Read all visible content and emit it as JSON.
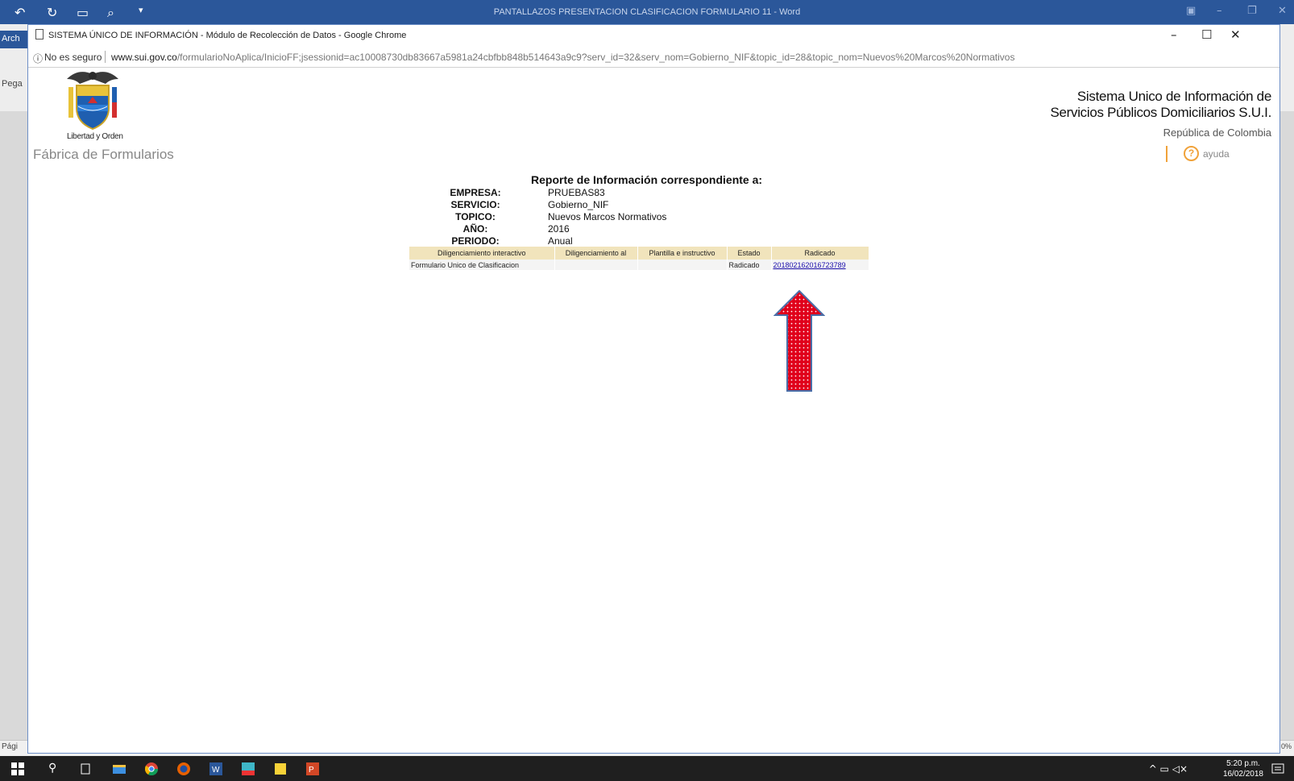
{
  "word": {
    "title": "PANTALLAZOS PRESENTACION CLASIFICACION FORMULARIO 11 - Word",
    "file_tab": "Arch",
    "paste_label": "Pega",
    "page_label": "Pági",
    "zoom_label": "0%"
  },
  "chrome": {
    "title": "SISTEMA ÚNICO DE INFORMACIÓN - Módulo de Recolección de Datos - Google Chrome",
    "insecure_label": "No es seguro",
    "url_host": "www.sui.gov.co",
    "url_path": "/formularioNoAplica/InicioFF;jsessionid=ac10008730db83667a5981a24cbfbb848b514643a9c9?serv_id=32&serv_nom=Gobierno_NIF&topic_id=28&topic_nom=Nuevos%20Marcos%20Normativos"
  },
  "header": {
    "crest_caption": "Libertad y Orden",
    "app_name": "Fábrica de Formularios",
    "sui_line1": "Sistema Unico de Información de",
    "sui_line2": "Servicios Públicos Domiciliarios S.U.I.",
    "country": "República de Colombia",
    "help_label": "ayuda"
  },
  "report": {
    "title": "Reporte de Información correspondiente a:",
    "fields": [
      {
        "label": "EMPRESA:",
        "value": "PRUEBAS83"
      },
      {
        "label": "SERVICIO:",
        "value": "Gobierno_NIF"
      },
      {
        "label": "TOPICO:",
        "value": "Nuevos Marcos Normativos"
      },
      {
        "label": "AÑO:",
        "value": "2016"
      },
      {
        "label": "PERIODO:",
        "value": "Anual"
      }
    ],
    "columns": [
      "Diligenciamiento interactivo",
      "Diligenciamiento al",
      "Plantilla e instructivo",
      "Estado",
      "Radicado"
    ],
    "rows": [
      [
        "Formulario Unico de Clasificacion",
        "",
        "",
        "Radicado",
        "201802162016723789"
      ]
    ]
  },
  "taskbar": {
    "time": "5:20 p.m.",
    "date": "16/02/2018"
  },
  "colors": {
    "word_blue": "#2b579a",
    "table_header": "#f1e4bc",
    "arrow_fill": "#e0001b",
    "help_orange": "#f0a23a"
  }
}
